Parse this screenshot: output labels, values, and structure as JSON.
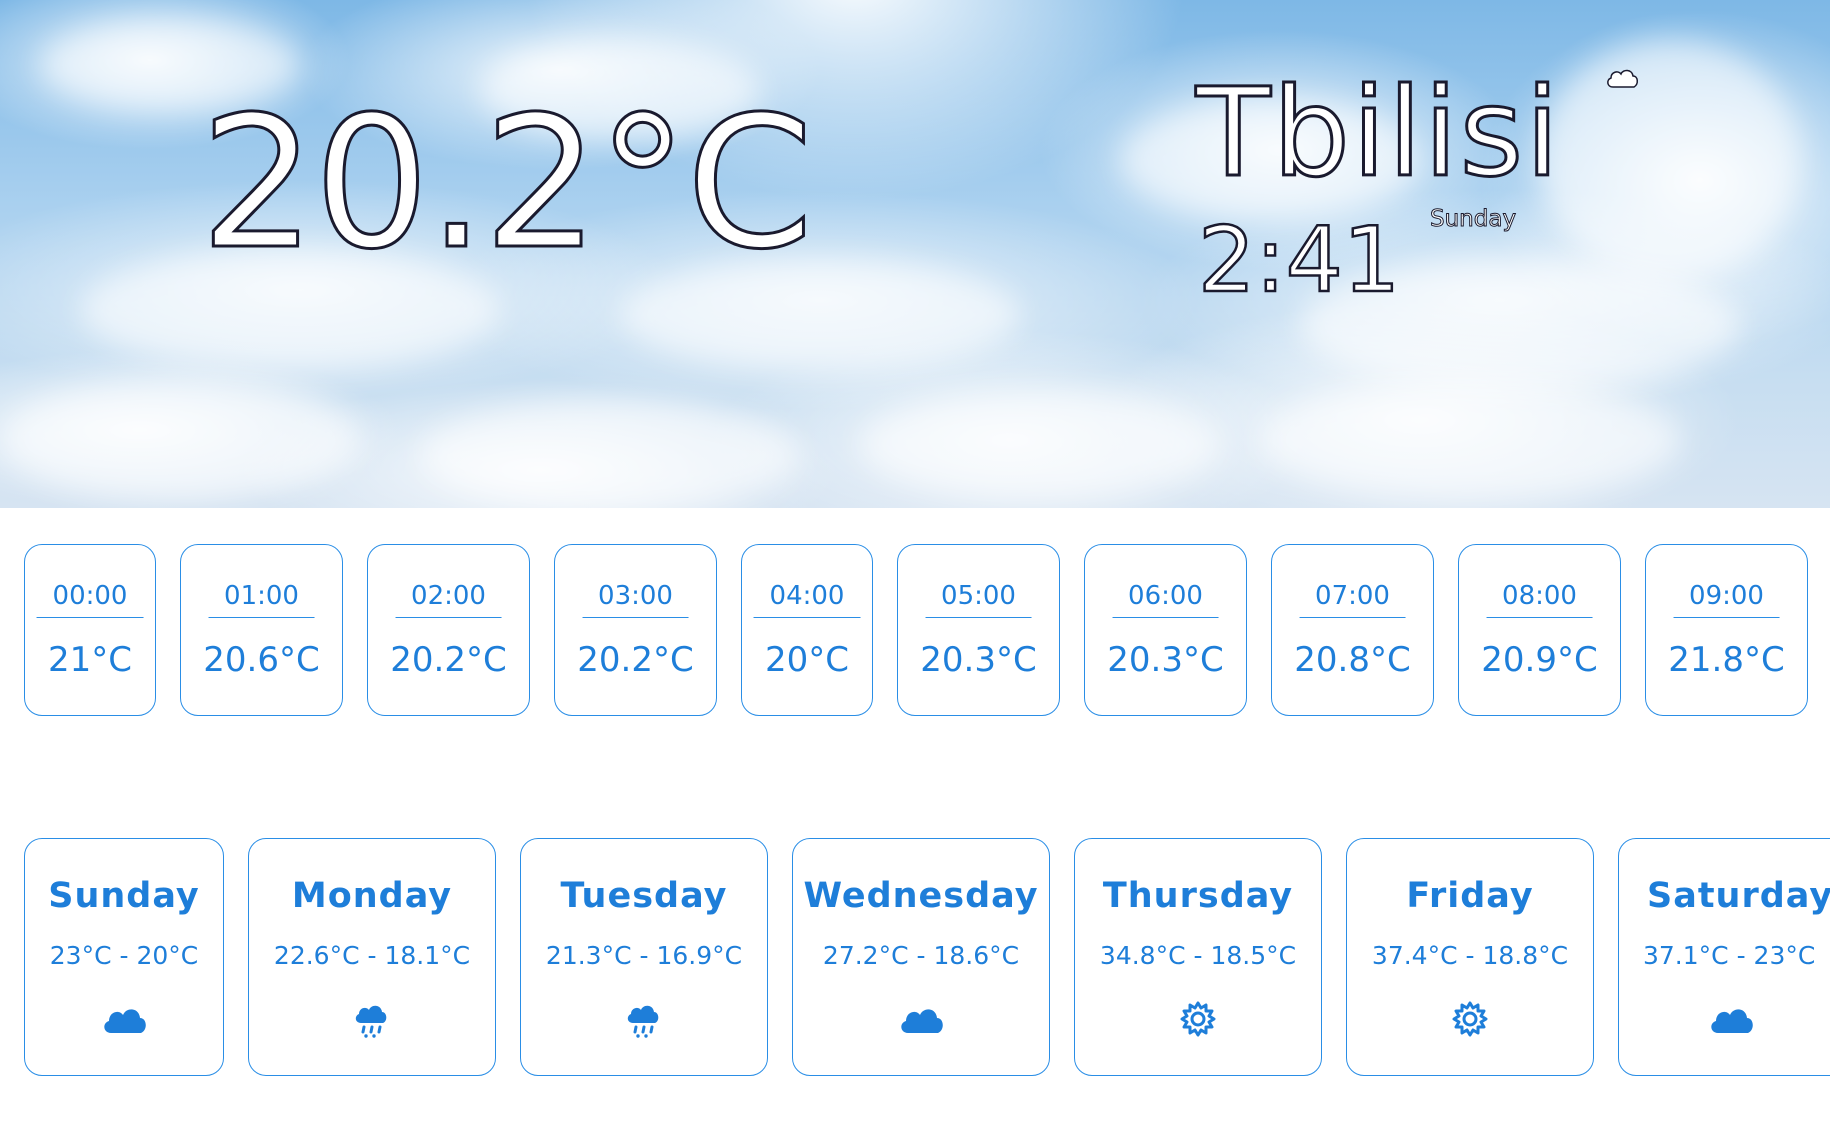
{
  "current": {
    "temperature": "20.2°C",
    "city": "Tbilisi",
    "time": "2:41",
    "day": "Sunday",
    "condition_icon": "cloud-icon"
  },
  "hourly": [
    {
      "time": "00:00",
      "temp": "21°C"
    },
    {
      "time": "01:00",
      "temp": "20.6°C"
    },
    {
      "time": "02:00",
      "temp": "20.2°C"
    },
    {
      "time": "03:00",
      "temp": "20.2°C"
    },
    {
      "time": "04:00",
      "temp": "20°C"
    },
    {
      "time": "05:00",
      "temp": "20.3°C"
    },
    {
      "time": "06:00",
      "temp": "20.3°C"
    },
    {
      "time": "07:00",
      "temp": "20.8°C"
    },
    {
      "time": "08:00",
      "temp": "20.9°C"
    },
    {
      "time": "09:00",
      "temp": "21.8°C"
    }
  ],
  "daily": [
    {
      "day": "Sunday",
      "range": "23°C - 20°C",
      "icon": "cloud-icon"
    },
    {
      "day": "Monday",
      "range": "22.6°C - 18.1°C",
      "icon": "rain-icon"
    },
    {
      "day": "Tuesday",
      "range": "21.3°C - 16.9°C",
      "icon": "rain-icon"
    },
    {
      "day": "Wednesday",
      "range": "27.2°C - 18.6°C",
      "icon": "cloud-icon"
    },
    {
      "day": "Thursday",
      "range": "34.8°C - 18.5°C",
      "icon": "sun-icon"
    },
    {
      "day": "Friday",
      "range": "37.4°C - 18.8°C",
      "icon": "sun-icon"
    },
    {
      "day": "Saturday",
      "range": "37.1°C - 23°C",
      "icon": "cloud-icon"
    }
  ],
  "colors": {
    "accent": "#1e7ed9",
    "border": "#2a8ee6",
    "outline": "#1a1a2e"
  }
}
